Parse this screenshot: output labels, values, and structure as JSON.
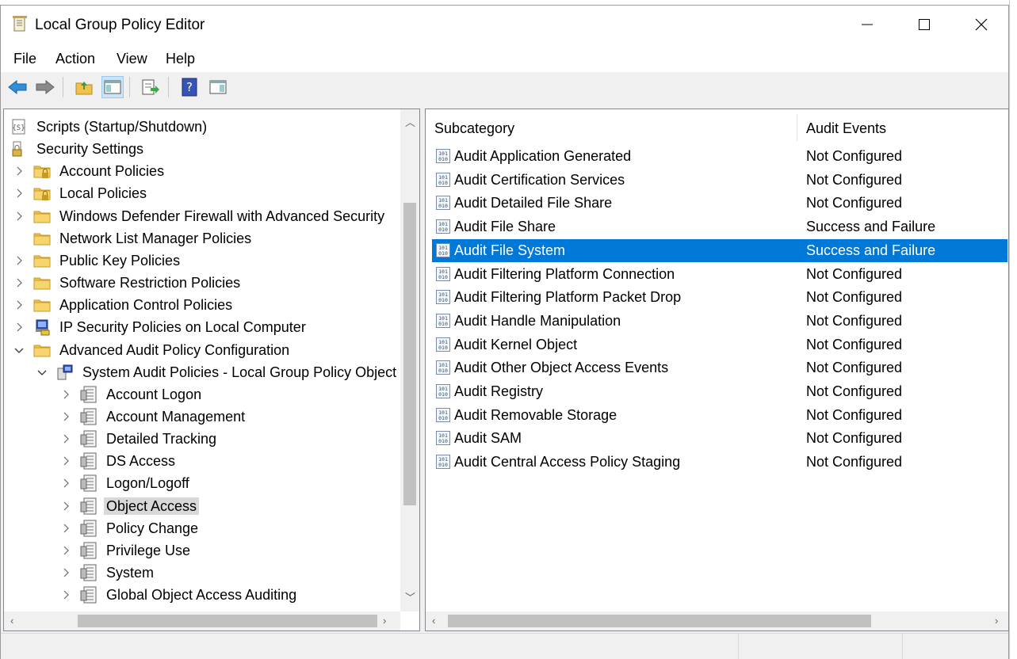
{
  "window": {
    "title": "Local Group Policy Editor",
    "minimize_glyph": "—",
    "maximize_glyph": "☐",
    "close_glyph": "✕"
  },
  "menu": {
    "items": [
      "File",
      "Action",
      "View",
      "Help"
    ]
  },
  "toolbar": {
    "buttons": [
      "back-arrow-icon",
      "forward-arrow-icon",
      "up-folder-icon",
      "show-hide-tree-icon",
      "export-list-icon",
      "help-icon",
      "show-hide-action-pane-icon"
    ]
  },
  "tree": {
    "items": [
      {
        "label": "Scripts (Startup/Shutdown)",
        "icon": "script-icon",
        "expander": ""
      },
      {
        "label": "Security Settings",
        "icon": "security-settings-icon",
        "expander": ""
      },
      {
        "label": "Account Policies",
        "icon": "folder-lock-icon",
        "expander": "›"
      },
      {
        "label": "Local Policies",
        "icon": "folder-lock-icon",
        "expander": "›"
      },
      {
        "label": "Windows Defender Firewall with Advanced Security",
        "icon": "folder-icon",
        "expander": "›"
      },
      {
        "label": "Network List Manager Policies",
        "icon": "folder-icon",
        "expander": ""
      },
      {
        "label": "Public Key Policies",
        "icon": "folder-icon",
        "expander": "›"
      },
      {
        "label": "Software Restriction Policies",
        "icon": "folder-icon",
        "expander": "›"
      },
      {
        "label": "Application Control Policies",
        "icon": "folder-icon",
        "expander": "›"
      },
      {
        "label": "IP Security Policies on Local Computer",
        "icon": "ip-security-icon",
        "expander": "›"
      },
      {
        "label": "Advanced Audit Policy Configuration",
        "icon": "folder-icon",
        "expander": "⌄"
      },
      {
        "label": "System Audit Policies - Local Group Policy Object",
        "icon": "audit-policies-icon",
        "expander": "⌄"
      },
      {
        "label": "Account Logon",
        "icon": "policy-category-icon",
        "expander": "›"
      },
      {
        "label": "Account Management",
        "icon": "policy-category-icon",
        "expander": "›"
      },
      {
        "label": "Detailed Tracking",
        "icon": "policy-category-icon",
        "expander": "›"
      },
      {
        "label": "DS Access",
        "icon": "policy-category-icon",
        "expander": "›"
      },
      {
        "label": "Logon/Logoff",
        "icon": "policy-category-icon",
        "expander": "›"
      },
      {
        "label": "Object Access",
        "icon": "policy-category-icon",
        "expander": "›",
        "selected": true
      },
      {
        "label": "Policy Change",
        "icon": "policy-category-icon",
        "expander": "›"
      },
      {
        "label": "Privilege Use",
        "icon": "policy-category-icon",
        "expander": "›"
      },
      {
        "label": "System",
        "icon": "policy-category-icon",
        "expander": "›"
      },
      {
        "label": "Global Object Access Auditing",
        "icon": "policy-category-icon",
        "expander": "›"
      }
    ]
  },
  "list": {
    "columns": [
      "Subcategory",
      "Audit Events"
    ],
    "rows": [
      {
        "name": "Audit Application Generated",
        "value": "Not Configured"
      },
      {
        "name": "Audit Certification Services",
        "value": "Not Configured"
      },
      {
        "name": "Audit Detailed File Share",
        "value": "Not Configured"
      },
      {
        "name": "Audit File Share",
        "value": "Success and Failure"
      },
      {
        "name": "Audit File System",
        "value": "Success and Failure",
        "selected": true
      },
      {
        "name": "Audit Filtering Platform Connection",
        "value": "Not Configured"
      },
      {
        "name": "Audit Filtering Platform Packet Drop",
        "value": "Not Configured"
      },
      {
        "name": "Audit Handle Manipulation",
        "value": "Not Configured"
      },
      {
        "name": "Audit Kernel Object",
        "value": "Not Configured"
      },
      {
        "name": "Audit Other Object Access Events",
        "value": "Not Configured"
      },
      {
        "name": "Audit Registry",
        "value": "Not Configured"
      },
      {
        "name": "Audit Removable Storage",
        "value": "Not Configured"
      },
      {
        "name": "Audit SAM",
        "value": "Not Configured"
      },
      {
        "name": "Audit Central Access Policy Staging",
        "value": "Not Configured"
      }
    ]
  },
  "colors": {
    "selection": "#0078d7",
    "tree_selection": "#d9d9d9",
    "folder": "#f0c24b"
  }
}
